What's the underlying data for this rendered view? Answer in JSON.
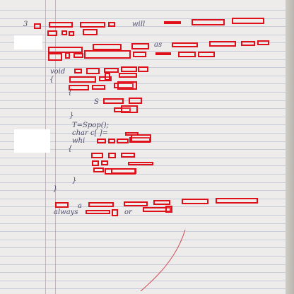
{
  "document": {
    "type": "handwritten notebook page with red bounding-box annotations",
    "lines": [
      {
        "name": "line-1",
        "text": "3"
      },
      {
        "name": "line-2",
        "text": "will"
      },
      {
        "name": "line-3",
        "text": "as"
      },
      {
        "name": "line-4",
        "text": "void"
      },
      {
        "name": "line-5",
        "text": "{"
      },
      {
        "name": "line-6",
        "text": "{"
      },
      {
        "name": "line-7",
        "text": "S"
      },
      {
        "name": "line-8",
        "text": "}"
      },
      {
        "name": "line-9",
        "text": "T=Spop();"
      },
      {
        "name": "line-10",
        "text": "char c[ ]="
      },
      {
        "name": "line-11",
        "text": "whi"
      },
      {
        "name": "line-12",
        "text": "{"
      },
      {
        "name": "line-13",
        "text": "}"
      },
      {
        "name": "line-14",
        "text": "}"
      },
      {
        "name": "line-15",
        "text": "a"
      },
      {
        "name": "line-16",
        "text": "always"
      },
      {
        "name": "line-17",
        "text": "or"
      }
    ],
    "annotation_color": "#e0101a",
    "ink_color": "#4a4a6a"
  }
}
